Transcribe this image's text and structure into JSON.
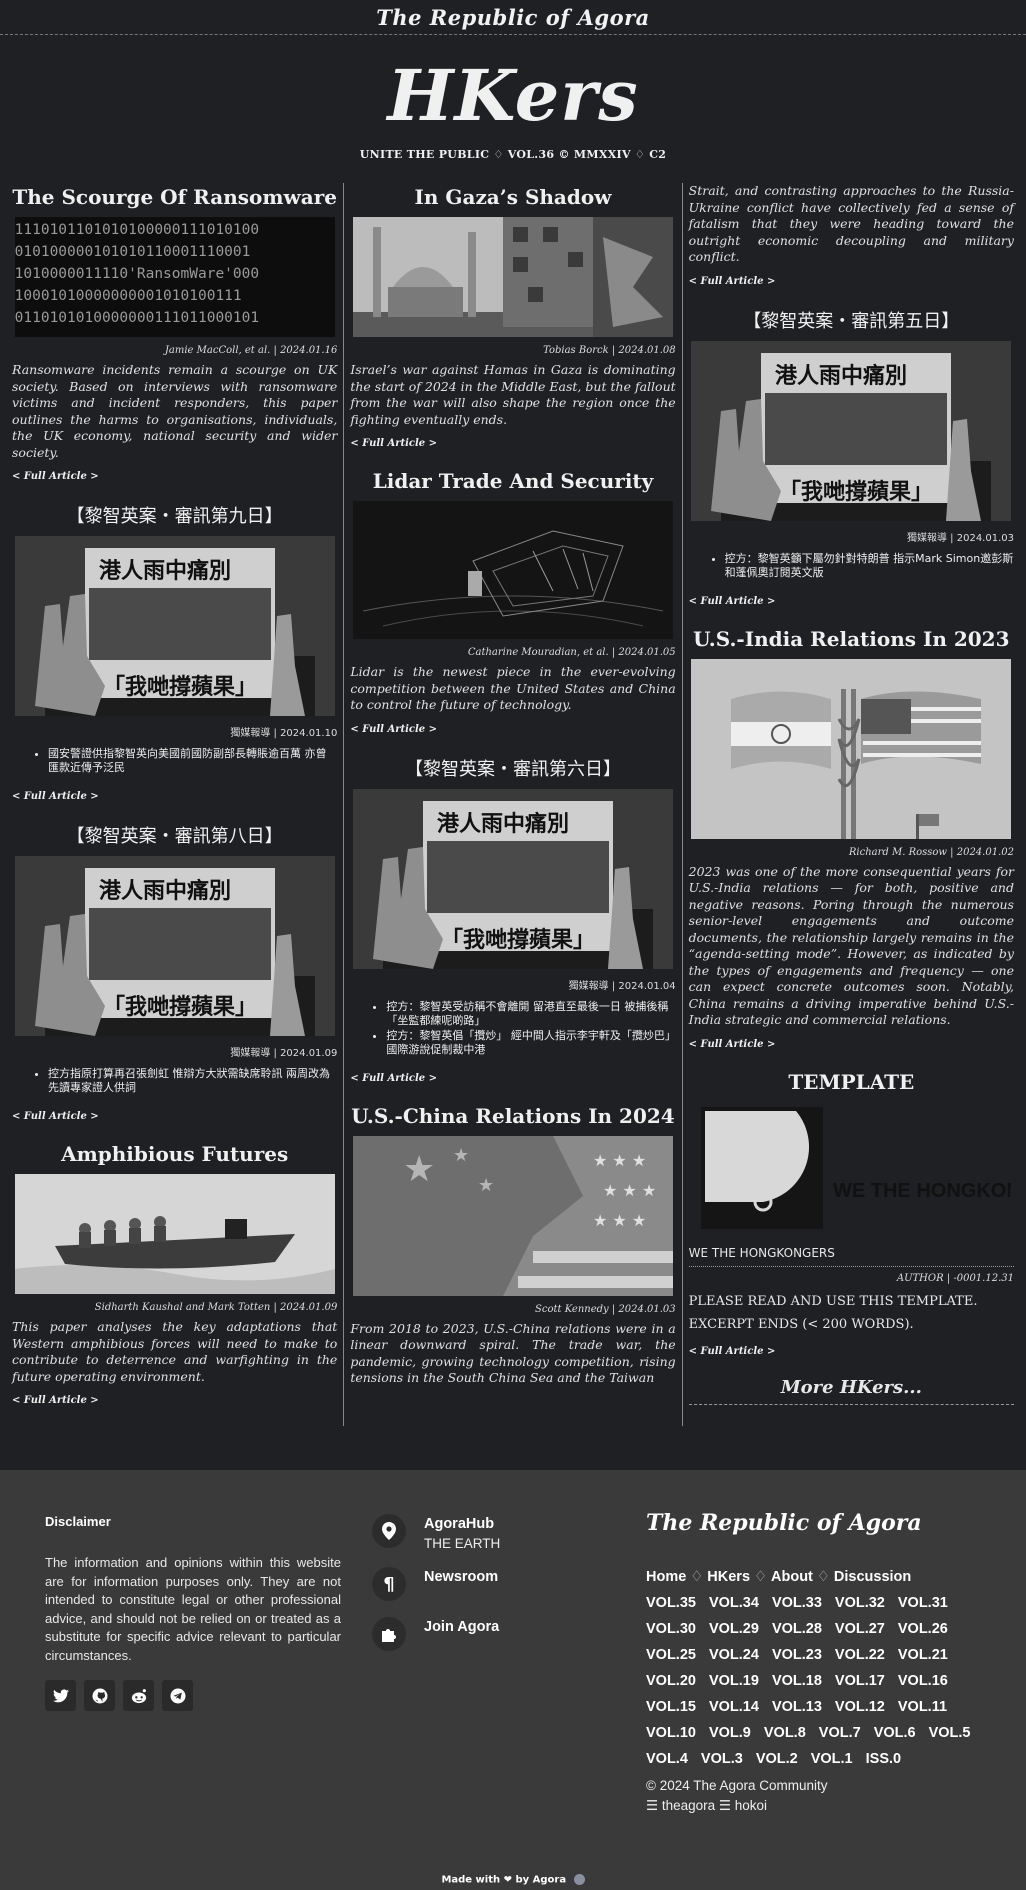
{
  "header": {
    "brand": "The Republic of Agora",
    "logo": "HKers",
    "issue_line": "UNITE THE PUBLIC ♢ VOL.36 © MMXXIV ♢ C2"
  },
  "articles": {
    "ransomware": {
      "title": "The Scourge Of Ransomware",
      "image_text": [
        "1110101101010100000111010100",
        "010100000101010110001110001",
        "1010000011110'RansomWare'000",
        "10001010000000001010100111",
        "0110101010000000111011000101"
      ],
      "byline": "Jamie MacColl, et al. | 2024.01.16",
      "excerpt": "Ransomware incidents remain a scourge on UK society. Based on interviews with ransomware victims and incident responders, this paper outlines the harms to organisations, individuals, the UK economy, national security and wider society.",
      "readmore": "< Full Article >"
    },
    "day9": {
      "title": "【黎智英案・審訊第九日】",
      "image_caption_top": "港人雨中痛別",
      "image_caption_bottom": "「我哋撐蘋果」",
      "byline": "獨媒報導 | 2024.01.10",
      "bullets": [
        "國安警證供指黎智英向美國前國防副部長轉賬逾百萬 亦曾匯款近傳予泛民"
      ],
      "readmore": "< Full Article >"
    },
    "day8": {
      "title": "【黎智英案・審訊第八日】",
      "image_caption_top": "港人雨中痛別",
      "image_caption_bottom": "「我哋撐蘋果」",
      "byline": "獨媒報導 | 2024.01.09",
      "bullets": [
        "控方指原打算再召張劍虹 惟辯方大狀需缺席聆訊 兩周改為先讀專家證人供詞"
      ],
      "readmore": "< Full Article >"
    },
    "amphibious": {
      "title": "Amphibious Futures",
      "byline": "Sidharth Kaushal and Mark Totten | 2024.01.09",
      "excerpt": "This paper analyses the key adaptations that Western amphibious forces will need to make to contribute to deterrence and warfighting in the future operating environment.",
      "readmore": "< Full Article >"
    },
    "gaza": {
      "title": "In Gaza’s Shadow",
      "byline": "Tobias Borck | 2024.01.08",
      "excerpt": "Israel’s war against Hamas in Gaza is dominating the start of 2024 in the Middle East, but the fallout from the war will also shape the region once the fighting eventually ends.",
      "readmore": "< Full Article >"
    },
    "lidar": {
      "title": "Lidar Trade And Security",
      "byline": "Catharine Mouradian, et al. | 2024.01.05",
      "excerpt": "Lidar is the newest piece in the ever-evolving competition between the United States and China to control the future of technology.",
      "readmore": "< Full Article >"
    },
    "day6": {
      "title": "【黎智英案・審訊第六日】",
      "image_caption_top": "港人雨中痛別",
      "image_caption_bottom": "「我哋撐蘋果」",
      "byline": "獨媒報導 | 2024.01.04",
      "bullets": [
        "控方：黎智英受訪稱不會離開 留港直至最後一日 被捕後稱「坐監都練呢啲路」",
        "控方：黎智英倡「攬炒」 經中間人指示李宇軒及「攬炒巴」國際游說促制裁中港"
      ],
      "readmore": "< Full Article >"
    },
    "uschina": {
      "title": "U.S.-China Relations In 2024",
      "byline": "Scott Kennedy | 2024.01.03",
      "excerpt": "From 2018 to 2023, U.S.-China relations were in a linear downward spiral. The trade war, the pandemic, growing technology competition, rising tensions in the South China Sea and the Taiwan",
      "excerpt_cont": "Strait, and contrasting approaches to the Russia-Ukraine conflict have collectively fed a sense of fatalism that they were heading toward the outright economic decoupling and military conflict.",
      "readmore": "< Full Article >"
    },
    "day5": {
      "title": "【黎智英案・審訊第五日】",
      "image_caption_top": "港人雨中痛別",
      "image_caption_bottom": "「我哋撐蘋果」",
      "byline": "獨媒報導 | 2024.01.03",
      "bullets": [
        "控方：黎智英籲下屬勿針對特朗普 指示Mark Simon邀彭斯和蓬佩奧訂閱英文版"
      ],
      "readmore": "< Full Article >"
    },
    "usindia": {
      "title": "U.S.-India Relations In 2023",
      "byline": "Richard M. Rossow | 2024.01.02",
      "excerpt": "2023 was one of the more consequential years for U.S.-India relations — for both, positive and negative reasons. Poring through the numerous senior-level engagements and outcome documents, the relationship largely remains in the “agenda-setting mode”. However, as indicated by the types of engagements and frequency — one can expect concrete outcomes soon. Notably, China remains a driving imperative behind U.S.-India strategic and commercial relations.",
      "readmore": "< Full Article >"
    },
    "template": {
      "title": "TEMPLATE",
      "image_text": "WE THE HONGKONGERS",
      "caption": "WE THE HONGKONGERS",
      "byline": "AUTHOR | -0001.12.31",
      "excerpt_line1": "PLEASE READ AND USE THIS TEMPLATE.",
      "excerpt_line2": "EXCERPT ENDS (< 200 WORDS).",
      "readmore": "< Full Article >"
    },
    "more": "More HKers..."
  },
  "footer": {
    "disclaimer_title": "Disclaimer",
    "disclaimer_text": "The information and opinions within this website are for information purposes only. They are not intended to constitute legal or other professional advice, and should not be relied on or treated as a substitute for specific advice relevant to particular circumstances.",
    "hubs": [
      {
        "name": "AgoraHub",
        "sub": "THE EARTH",
        "icon": "map-pin-icon"
      },
      {
        "name": "Newsroom",
        "sub": "",
        "icon": "pilcrow-icon"
      },
      {
        "name": "Join Agora",
        "sub": "",
        "icon": "puzzle-icon"
      }
    ],
    "brand": "The Republic of Agora",
    "nav": [
      "Home",
      "HKers",
      "About",
      "Discussion"
    ],
    "nav_sep": "♢",
    "volumes": [
      "VOL.35",
      "VOL.34",
      "VOL.33",
      "VOL.32",
      "VOL.31",
      "VOL.30",
      "VOL.29",
      "VOL.28",
      "VOL.27",
      "VOL.26",
      "VOL.25",
      "VOL.24",
      "VOL.23",
      "VOL.22",
      "VOL.21",
      "VOL.20",
      "VOL.19",
      "VOL.18",
      "VOL.17",
      "VOL.16",
      "VOL.15",
      "VOL.14",
      "VOL.13",
      "VOL.12",
      "VOL.11",
      "VOL.10",
      "VOL.9",
      "VOL.8",
      "VOL.7",
      "VOL.6",
      "VOL.5",
      "VOL.4",
      "VOL.3",
      "VOL.2",
      "VOL.1",
      "ISS.0"
    ],
    "copyright": "© 2024 The Agora Community",
    "links": "☰ theagora ☰ hokoi",
    "made_with": "Made with ❤ by Agora"
  }
}
